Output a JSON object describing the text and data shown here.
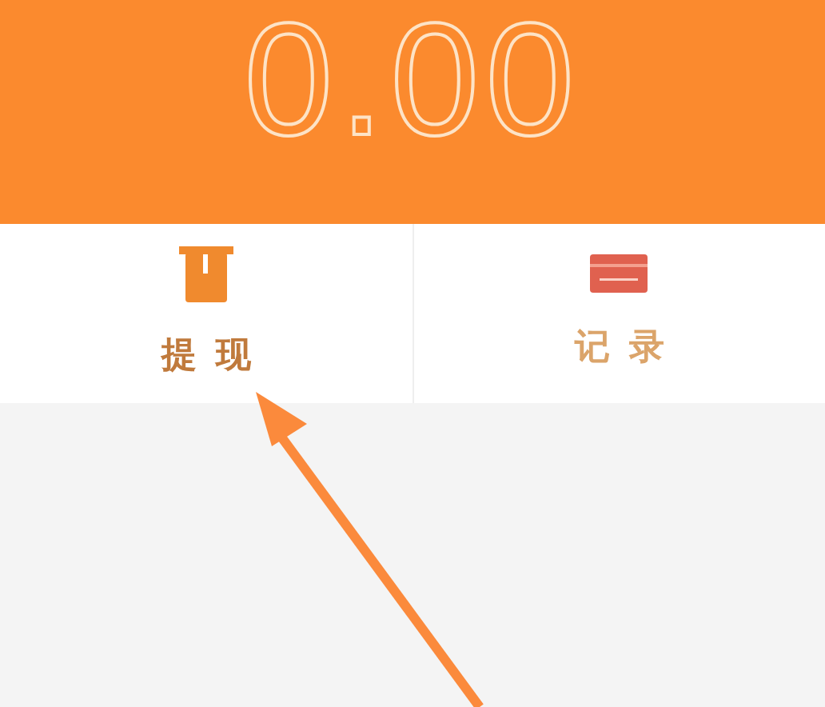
{
  "balance": "0.00",
  "actions": [
    {
      "label": "提现",
      "kind": "withdraw"
    },
    {
      "label": "记录",
      "kind": "records"
    }
  ]
}
